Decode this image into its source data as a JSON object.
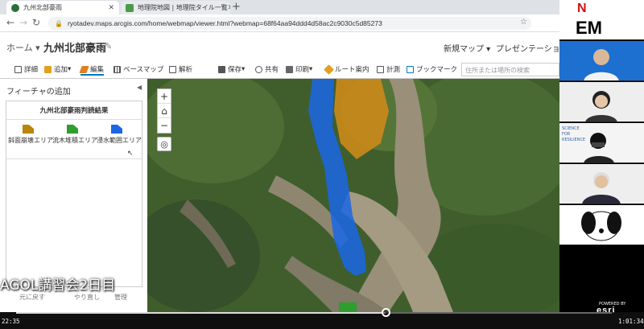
{
  "browser": {
    "tabs": [
      {
        "title": "九州北部豪雨",
        "active": true
      },
      {
        "title": "地理院地図 | 地理院タイル一覧",
        "active": false
      }
    ],
    "url": "ryotadev.maps.arcgis.com/home/webmap/viewer.html?webmap=68f64aa94ddd4d58ac2c9030c5d85273"
  },
  "header": {
    "home": "ホーム",
    "map_title": "九州北部豪雨",
    "new_map": "新規マップ",
    "presentation": "プレゼンテーション"
  },
  "toolbar": {
    "details": "詳細",
    "add": "追加",
    "edit": "編集",
    "basemap": "ベースマップ",
    "analysis": "解析",
    "save": "保存",
    "share": "共有",
    "print": "印刷",
    "directions": "ルート案内",
    "measure": "計測",
    "bookmarks": "ブックマーク",
    "search_placeholder": "住所または場所の検索"
  },
  "panel": {
    "heading": "フィーチャの追加",
    "template_group": "九州北部豪雨判読結果",
    "templates": [
      {
        "label": "斜面崩壊エリア",
        "color": "#b8860b"
      },
      {
        "label": "流木堆積エリア",
        "color": "#2e9e2e"
      },
      {
        "label": "浸水範囲エリア",
        "color": "#1a66e6"
      }
    ],
    "footer_buttons": [
      "元に戻す",
      "やり直し",
      "管理"
    ]
  },
  "overlay": {
    "caption": "AGOL講習会2日目"
  },
  "map": {
    "zoom_in": "+",
    "home": "⌂",
    "zoom_out": "−",
    "locate": "◎"
  },
  "video": {
    "logo_top": "N",
    "logo_mid": "EM",
    "science_label": "SCIENCE FOR RESILIENCE"
  },
  "player": {
    "elapsed": "22:35",
    "total": "1:01:34",
    "progress": 0.62,
    "brand": "esri",
    "powered_by": "POWERED BY"
  }
}
